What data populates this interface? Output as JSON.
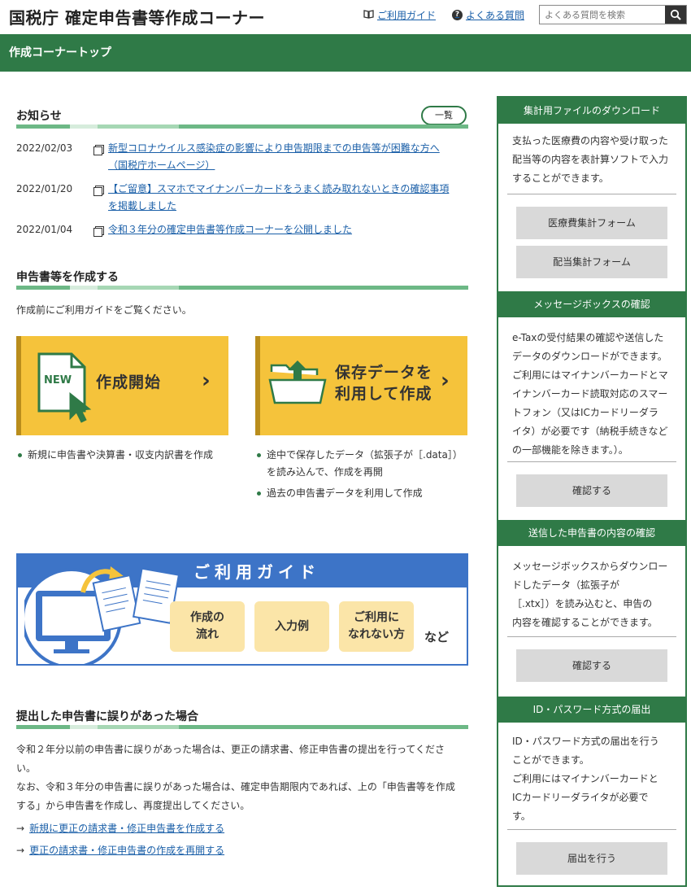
{
  "header": {
    "site_title": "国税庁 確定申告書等作成コーナー",
    "guide_link": "ご利用ガイド",
    "faq_link": "よくある質問",
    "search_placeholder": "よくある質問を検索",
    "page_title": "作成コーナートップ"
  },
  "news": {
    "title": "お知らせ",
    "list_button": "一覧",
    "items": [
      {
        "date": "2022/02/03",
        "text_line1": "新型コロナウイルス感染症の影響により申告期限までの申告等が困難な方へ",
        "text_line2": "（国税庁ホームページ）"
      },
      {
        "date": "2022/01/20",
        "text_line1": "【ご留意】スマホでマイナンバーカードをうまく読み取れないときの確認事項",
        "text_line2": "を掲載しました"
      },
      {
        "date": "2022/01/04",
        "text_line1": "令和３年分の確定申告書等作成コーナーを公開しました",
        "text_line2": ""
      }
    ]
  },
  "create": {
    "title": "申告書等を作成する",
    "lead": "作成前にご利用ガイドをご覧ください。",
    "new_card": {
      "badge": "NEW",
      "label": "作成開始"
    },
    "saved_card": {
      "label_line1": "保存データを",
      "label_line2": "利用して作成"
    },
    "new_bullets": [
      "新規に申告書や決算書・収支内訳書を作成"
    ],
    "saved_bullets": [
      "途中で保存したデータ（拡張子が［.data］）",
      "を読み込んで、作成を再開",
      "過去の申告書データを利用して作成"
    ]
  },
  "guide_banner": {
    "title": "ご利用ガイド",
    "tiles": [
      {
        "line1": "作成の",
        "line2": "流れ"
      },
      {
        "line1": "入力例",
        "line2": ""
      },
      {
        "line1": "ご利用に",
        "line2": "なれない方"
      }
    ],
    "etc": "など"
  },
  "error_section": {
    "title": "提出した申告書に誤りがあった場合",
    "para1_line1": "令和２年分以前の申告書に誤りがあった場合は、更正の請求書、修正申告書の提出を行ってくださ",
    "para1_line2": "い。",
    "para2_line1": "なお、令和３年分の申告書に誤りがあった場合は、確定申告期限内であれば、上の「申告書等を作成",
    "para2_line2": "する」から申告書を作成し、再度提出してください。",
    "link1": "新規に更正の請求書・修正申告書を作成する",
    "link2": "更正の請求書・修正申告書の作成を再開する"
  },
  "sidebar": {
    "download": {
      "title": "集計用ファイルのダウンロード",
      "text": [
        "支払った医療費の内容や受け取った",
        "配当等の内容を表計算ソフトで入力",
        "することができます。"
      ],
      "button1": "医療費集計フォーム",
      "button2": "配当集計フォーム"
    },
    "message": {
      "title": "メッセージボックスの確認",
      "text": [
        "e-Taxの受付結果の確認や送信した",
        "データのダウンロードができます。",
        "ご利用にはマイナンバーカードとマ",
        "イナンバーカード読取対応のスマー",
        "トフォン（又はICカードリーダラ",
        "イタ）が必要です（納税手続きなど",
        "の一部機能を除きます。）。"
      ],
      "button": "確認する"
    },
    "sent": {
      "title": "送信した申告書の内容の確認",
      "text": [
        "メッセージボックスからダウンロー",
        "ドしたデータ（拡張子が",
        "［.xtx］）を読み込むと、申告の",
        "内容を確認することができます。"
      ],
      "button": "確認する"
    },
    "idpw": {
      "title": "ID・パスワード方式の届出",
      "text": [
        "ID・パスワード方式の届出を行う",
        "ことができます。",
        "ご利用にはマイナンバーカードと",
        "ICカードリーダライタが必要で",
        "す。"
      ],
      "button": "届出を行う"
    }
  },
  "colors": {
    "green": "#2f7a47",
    "yellow": "#f5c33b",
    "blue": "#3d74c7",
    "link": "#1a5fa8"
  }
}
